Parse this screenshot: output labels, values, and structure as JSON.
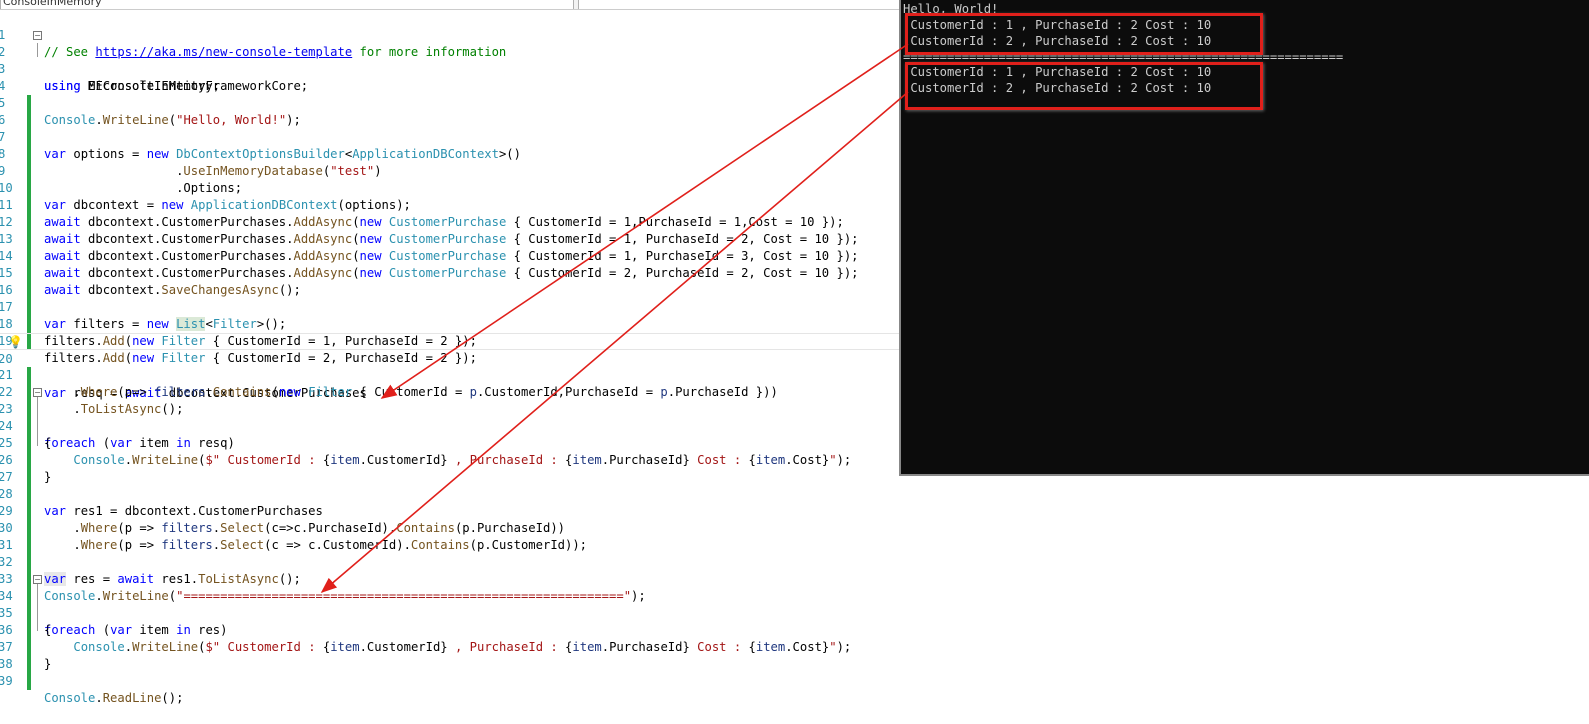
{
  "editor": {
    "project_combo": "ConsoleInMemory",
    "line_numbers": [
      "1",
      "2",
      "3",
      "4",
      "5",
      "6",
      "7",
      "8",
      "9",
      "10",
      "11",
      "12",
      "13",
      "14",
      "15",
      "16",
      "17",
      "18",
      "19",
      "20",
      "21",
      "22",
      "23",
      "24",
      "25",
      "26",
      "27",
      "28",
      "29",
      "30",
      "31",
      "32",
      "33",
      "34",
      "35",
      "36",
      "37",
      "38",
      "39"
    ]
  },
  "code": {
    "l1_comment": "// See ",
    "l1_link": "https://aka.ms/new-console-template",
    "l1_tail": " for more information",
    "l2_kw": "using",
    "l2_ns": " EFConsoleInMemory;",
    "l3_kw": "using",
    "l3_ns": " Microsoft.EntityFrameworkCore;",
    "l5_a": "Console",
    "l5_b": ".",
    "l5_c": "WriteLine",
    "l5_d": "(",
    "l5_e": "\"Hello, World!\"",
    "l5_f": ");",
    "l7_a": "var",
    "l7_b": " options = ",
    "l7_c": "new",
    "l7_d": " ",
    "l7_e": "DbContextOptionsBuilder",
    "l7_f": "<",
    "l7_g": "ApplicationDBContext",
    "l7_h": ">()",
    "l8_a": "                  .",
    "l8_b": "UseInMemoryDatabase",
    "l8_c": "(",
    "l8_d": "\"test\"",
    "l8_e": ")",
    "l9_a": "                  .Options;",
    "l10_a": "var",
    "l10_b": " dbcontext = ",
    "l10_c": "new",
    "l10_d": " ",
    "l10_e": "ApplicationDBContext",
    "l10_f": "(options);",
    "l11_a": "await",
    "l11_b": " dbcontext.CustomerPurchases.",
    "l11_c": "AddAsync",
    "l11_d": "(",
    "l11_e": "new",
    "l11_f": " ",
    "l11_g": "CustomerPurchase",
    "l11_h": " { CustomerId = 1,PurchaseId = 1,Cost = 10 });",
    "l12_a": "await",
    "l12_b": " dbcontext.CustomerPurchases.",
    "l12_c": "AddAsync",
    "l12_d": "(",
    "l12_e": "new",
    "l12_f": " ",
    "l12_g": "CustomerPurchase",
    "l12_h": " { CustomerId = 1, PurchaseId = 2, Cost = 10 });",
    "l13_a": "await",
    "l13_b": " dbcontext.CustomerPurchases.",
    "l13_c": "AddAsync",
    "l13_d": "(",
    "l13_e": "new",
    "l13_f": " ",
    "l13_g": "CustomerPurchase",
    "l13_h": " { CustomerId = 1, PurchaseId = 3, Cost = 10 });",
    "l14_a": "await",
    "l14_b": " dbcontext.CustomerPurchases.",
    "l14_c": "AddAsync",
    "l14_d": "(",
    "l14_e": "new",
    "l14_f": " ",
    "l14_g": "CustomerPurchase",
    "l14_h": " { CustomerId = 2, PurchaseId = 2, Cost = 10 });",
    "l15_a": "await",
    "l15_b": " dbcontext.",
    "l15_c": "SaveChangesAsync",
    "l15_d": "();",
    "l17_a": "var",
    "l17_b": " filters = ",
    "l17_c": "new",
    "l17_d": " ",
    "l17_e": "List",
    "l17_f": "<",
    "l17_g": "Filter",
    "l17_h": ">();",
    "l18_a": "filters.",
    "l18_b": "Add",
    "l18_c": "(",
    "l18_d": "new",
    "l18_e": " ",
    "l18_f": "Filter",
    "l18_g": " { CustomerId = 1, PurchaseId = 2 });",
    "l19_a": "filters.",
    "l19_b": "Add",
    "l19_c": "(",
    "l19_d": "new",
    "l19_e": " ",
    "l19_f": "Filter",
    "l19_g": " { CustomerId = 2, PurchaseId = 2 });",
    "l20_a": "var",
    "l20_b": " resq = ",
    "l20_c": "await",
    "l20_d": " dbcontext.CustomerPurchases",
    "l21_a": "    .",
    "l21_b": "Where",
    "l21_c": "(p=> ",
    "l21_d": "filters",
    "l21_e": ".",
    "l21_f": "Contains",
    "l21_g": "(",
    "l21_h": "new",
    "l21_i": " ",
    "l21_j": "Filter",
    "l21_k": " { CustomerId = ",
    "l21_l": "p",
    "l21_m": ".CustomerId,PurchaseId = ",
    "l21_n": "p",
    "l21_o": ".PurchaseId }))",
    "l22_a": "    .",
    "l22_b": "ToListAsync",
    "l22_c": "();",
    "l23_a": "foreach",
    "l23_b": " (",
    "l23_c": "var",
    "l23_d": " item ",
    "l23_e": "in",
    "l23_f": " resq)",
    "l24_a": "{",
    "l25_a": "    ",
    "l25_b": "Console",
    "l25_c": ".",
    "l25_d": "WriteLine",
    "l25_e": "(",
    "l25_f": "$\" CustomerId : ",
    "l25_g": "{",
    "l25_h": "item",
    "l25_i": ".CustomerId}",
    "l25_j": " , PurchaseId : ",
    "l25_k": "{",
    "l25_l": "item",
    "l25_m": ".PurchaseId}",
    "l25_n": " Cost : ",
    "l25_o": "{",
    "l25_p": "item",
    "l25_q": ".Cost}",
    "l25_r": "\"",
    "l25_s": ");",
    "l26_a": "}",
    "l28_a": "var",
    "l28_b": " res1 = dbcontext.CustomerPurchases",
    "l29_a": "    .",
    "l29_b": "Where",
    "l29_c": "(p => ",
    "l29_d": "filters",
    "l29_e": ".",
    "l29_f": "Select",
    "l29_g": "(c=>c.PurchaseId).",
    "l29_h": "Contains",
    "l29_i": "(p.PurchaseId))",
    "l30_a": "    .",
    "l30_b": "Where",
    "l30_c": "(p => ",
    "l30_d": "filters",
    "l30_e": ".",
    "l30_f": "Select",
    "l30_g": "(c => c.CustomerId).",
    "l30_h": "Contains",
    "l30_i": "(p.CustomerId));",
    "l32_a": "var",
    "l32_b": " res = ",
    "l32_c": "await",
    "l32_d": " res1.",
    "l32_e": "ToListAsync",
    "l32_f": "();",
    "l33_a": "Console",
    "l33_b": ".",
    "l33_c": "WriteLine",
    "l33_d": "(",
    "l33_e": "\"============================================================\"",
    "l33_f": ");",
    "l34_a": "foreach",
    "l34_b": " (",
    "l34_c": "var",
    "l34_d": " item ",
    "l34_e": "in",
    "l34_f": " res)",
    "l35_a": "{",
    "l36_a": "    ",
    "l36_b": "Console",
    "l36_c": ".",
    "l36_d": "WriteLine",
    "l36_e": "(",
    "l36_f": "$\" CustomerId : ",
    "l36_g": "{",
    "l36_h": "item",
    "l36_i": ".CustomerId}",
    "l36_j": " , PurchaseId : ",
    "l36_k": "{",
    "l36_l": "item",
    "l36_m": ".PurchaseId}",
    "l36_n": " Cost : ",
    "l36_o": "{",
    "l36_p": "item",
    "l36_q": ".Cost}",
    "l36_r": "\"",
    "l36_s": ");",
    "l37_a": "}",
    "l39_a": "Console",
    "l39_b": ".",
    "l39_c": "ReadLine",
    "l39_d": "();"
  },
  "console": {
    "lines": [
      "Hello, World!",
      " CustomerId : 1 , PurchaseId : 2 Cost : 10",
      " CustomerId : 2 , PurchaseId : 2 Cost : 10",
      "============================================================",
      " CustomerId : 1 , PurchaseId : 2 Cost : 10",
      " CustomerId : 2 , PurchaseId : 2 Cost : 10"
    ]
  },
  "annotation": {
    "color": "#e0201b"
  }
}
